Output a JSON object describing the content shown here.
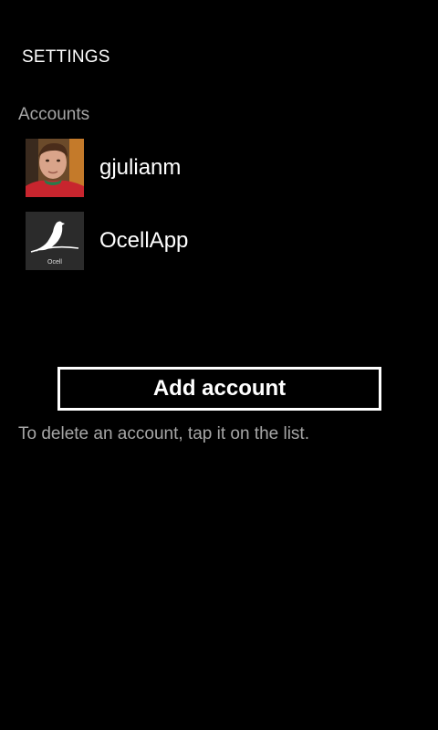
{
  "page": {
    "title": "SETTINGS"
  },
  "accounts_section": {
    "header": "Accounts",
    "items": [
      {
        "name": "gjulianm",
        "avatar": "user-photo"
      },
      {
        "name": "OcellApp",
        "avatar": "ocell-bird-logo",
        "avatar_caption": "Ocell"
      }
    ]
  },
  "actions": {
    "add_account_label": "Add account"
  },
  "hint": {
    "text": "To delete an account, tap it on the list."
  },
  "colors": {
    "background": "#000000",
    "foreground": "#ffffff",
    "subtle_text": "#a6a6a6"
  }
}
